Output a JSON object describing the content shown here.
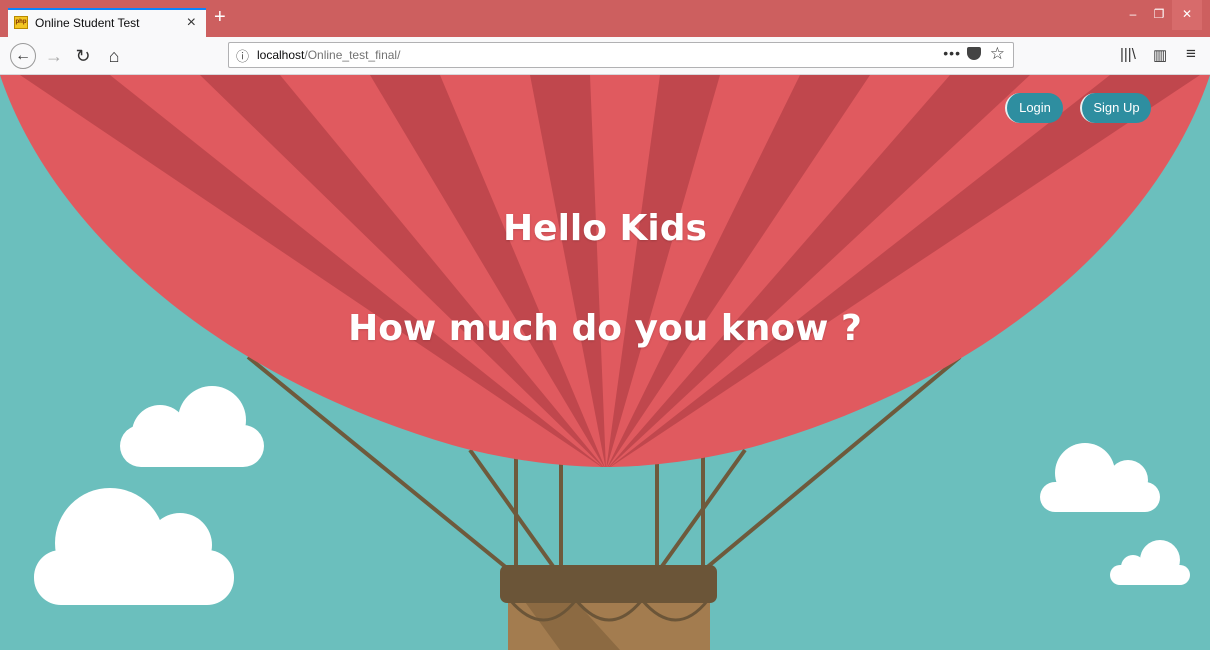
{
  "browser": {
    "tab_title": "Online Student Test",
    "favicon_text": "php",
    "tab_close": "×",
    "new_tab": "+",
    "url_info_icon": "ⓘ",
    "url_host": "localhost",
    "url_path": "/Online_test_final/",
    "page_actions": "•••",
    "star": "☆",
    "back": "←",
    "forward": "→",
    "reload": "↻",
    "home": "⌂",
    "library": "|||\\",
    "sidebar": "▥",
    "menu": "≡",
    "min": "–",
    "restore": "❐",
    "close": "✕"
  },
  "page": {
    "heading": "Hello Kids",
    "subheading": "How much do you know ?",
    "nav": {
      "login_label": "Login",
      "signup_label": "Sign Up"
    },
    "colors": {
      "sky": "#6bbfbd",
      "balloon_light": "#e05a5f",
      "balloon_dark": "#c0474d",
      "rope": "#6e5a3c",
      "basket_rim": "#6b5538",
      "basket": "#a37c4f",
      "cloud": "#ffffff",
      "button": "#2e8ea0"
    }
  }
}
